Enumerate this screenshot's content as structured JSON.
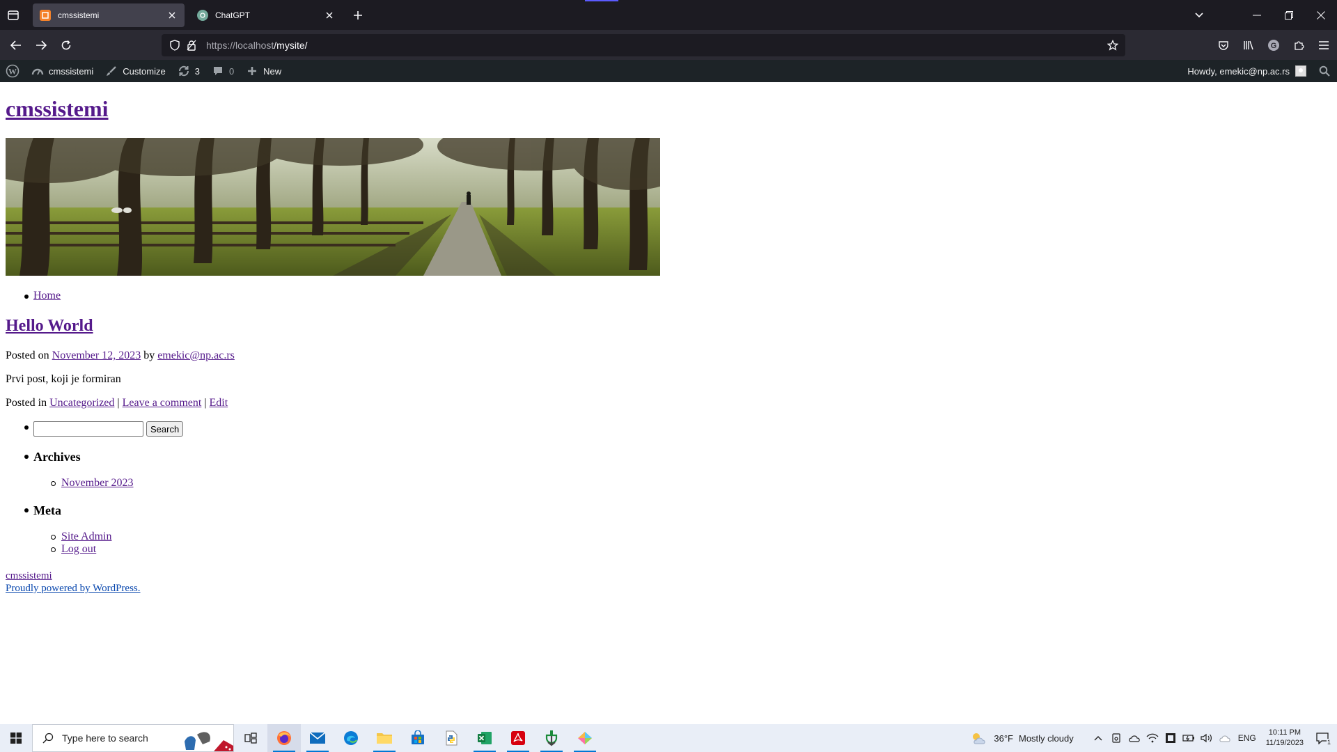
{
  "browser": {
    "tabs": [
      {
        "title": "cmssistemi",
        "active": true,
        "favicon": "wordpress-local-favicon"
      },
      {
        "title": "ChatGPT",
        "active": false,
        "favicon": "chatgpt-favicon"
      }
    ],
    "url_host": "https://localhost",
    "url_path": "/mysite/"
  },
  "adminbar": {
    "site_name": "cmssistemi",
    "customize": "Customize",
    "updates_count": "3",
    "comments_count": "0",
    "new_label": "New",
    "howdy": "Howdy, emekic@np.ac.rs"
  },
  "site": {
    "title": "cmssistemi",
    "menu": [
      "Home"
    ]
  },
  "post": {
    "title": "Hello World",
    "posted_on_prefix": "Posted on",
    "date": "November 12, 2023",
    "by": "by",
    "author": "emekic@np.ac.rs",
    "body": "Prvi post, koji je formiran",
    "posted_in_prefix": "Posted in",
    "category": "Uncategorized",
    "sep": "|",
    "leave_comment": "Leave a comment",
    "edit": "Edit"
  },
  "widgets": {
    "search_button": "Search",
    "archives_title": "Archives",
    "archives": [
      "November 2023"
    ],
    "meta_title": "Meta",
    "meta_links": [
      "Site Admin",
      "Log out"
    ]
  },
  "footer": {
    "site_name": "cmssistemi",
    "powered": "Proudly powered by WordPress."
  },
  "taskbar": {
    "search_placeholder": "Type here to search",
    "weather_temp": "36°F",
    "weather_desc": "Mostly cloudy",
    "language": "ENG",
    "time": "10:11 PM",
    "date": "11/19/2023",
    "notification_count": "1",
    "accent": "#0078d4"
  }
}
